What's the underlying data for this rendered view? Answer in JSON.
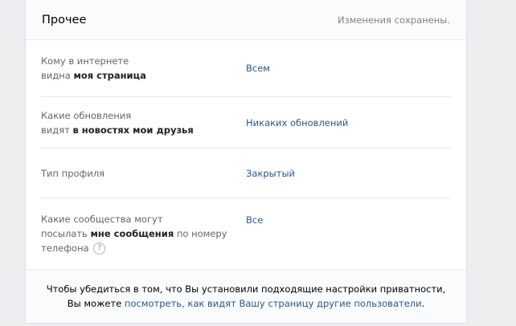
{
  "section": {
    "title": "Прочее",
    "status": "Изменения сохранены."
  },
  "rows": [
    {
      "label_pre": "Кому в интернете",
      "label_mid_pre": "видна ",
      "label_bold": "моя страница",
      "value": "Всем"
    },
    {
      "label_pre": "Какие обновления",
      "label_mid_pre": "видят ",
      "label_bold": "в новостях мои друзья",
      "value": "Никаких обновлений"
    },
    {
      "label": "Тип профиля",
      "value": "Закрытый"
    },
    {
      "label_pre": "Какие сообщества могут",
      "label_mid_pre": "посылать ",
      "label_bold": "мне сообщения",
      "label_post": " по номеру",
      "label_end": "телефона",
      "help": "?",
      "value": "Все"
    }
  ],
  "footer": {
    "line1": "Чтобы убедиться в том, что Вы установили подходящие настройки приватности,",
    "line2_pre": "Вы можете ",
    "link": "посмотреть, как видят Вашу страницу другие пользователи",
    "line2_post": "."
  }
}
